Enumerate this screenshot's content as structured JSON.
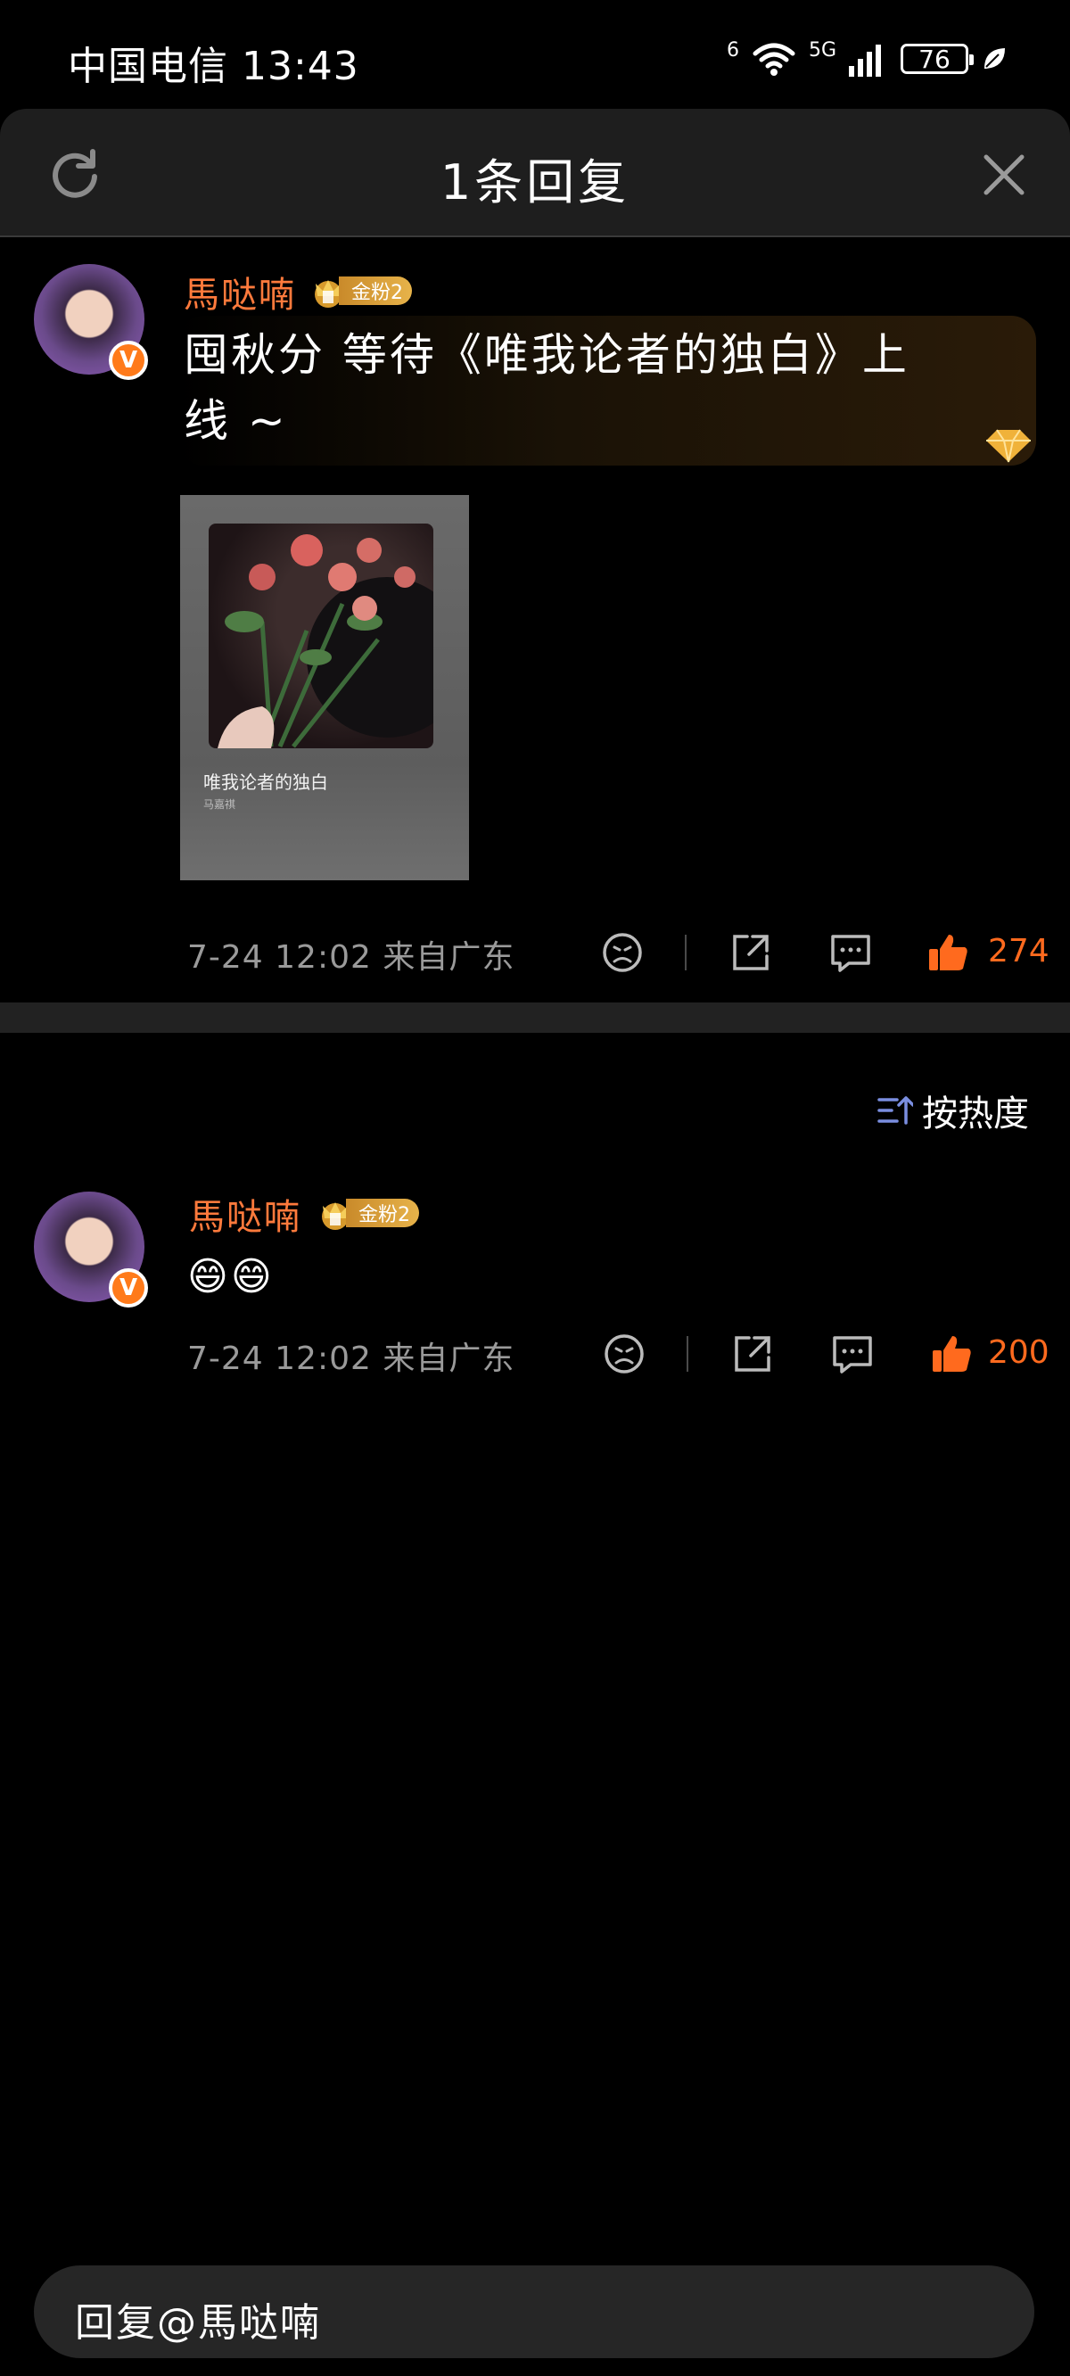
{
  "status_bar": {
    "carrier_time": "中国电信 13:43",
    "wifi_label": "6",
    "network": "5G",
    "battery": "76"
  },
  "header": {
    "title": "1条回复"
  },
  "main_comment": {
    "username": "馬哒喃",
    "fan_badge": "金粉2",
    "text_line1": "囤秋分 等待《唯我论者的独白》上",
    "text_line2": "线 ~",
    "music_card": {
      "title": "唯我论者的独白",
      "artist": "马嘉祺"
    },
    "meta": "7-24 12:02 来自广东",
    "likes": "274"
  },
  "sort": {
    "label": "按热度"
  },
  "reply_comment": {
    "username": "馬哒喃",
    "fan_badge": "金粉2",
    "emoji": "😄😄",
    "meta": "7-24 12:02 来自广东",
    "likes": "200"
  },
  "reply_input": {
    "placeholder": "回复@馬哒喃"
  },
  "colors": {
    "accent": "#ff7a3c",
    "like": "#ff6a1e",
    "background": "#000000",
    "header_bg": "#1e1e1e"
  }
}
